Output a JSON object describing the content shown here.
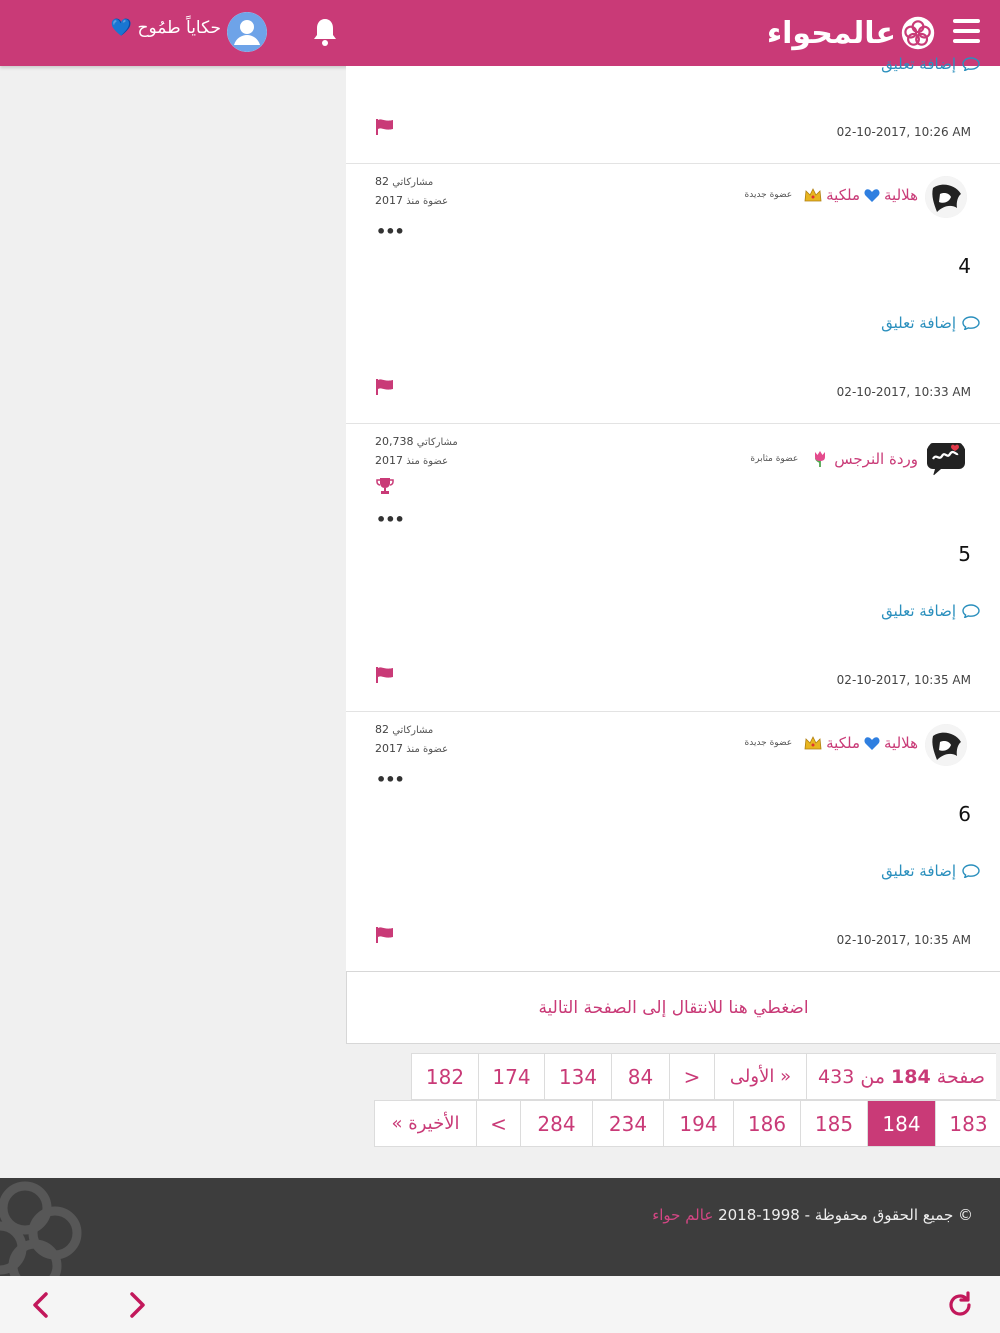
{
  "header": {
    "logo_text": "عالمحواء",
    "username": "حكاياً طمُوح 💙",
    "icons": {
      "menu": "hamburger-icon",
      "notifications": "bell-icon",
      "account": "avatar-icon"
    }
  },
  "colors": {
    "brand": "#c93a77",
    "link": "#2a8fbd",
    "footer": "#3d3d3d"
  },
  "top_partial": {
    "add_comment": "إضافة تعليق",
    "timestamp": "02-10-2017, 10:26 AM"
  },
  "posts": [
    {
      "author": "هلالية",
      "author_suffix": "ملكية",
      "rank": "عضوة جديدة",
      "posts_label": "مشاركاتي",
      "posts_count": "82",
      "member_since_label": "عضوة منذ",
      "member_since": "2017",
      "menu": "•••",
      "body": "4",
      "add_comment": "إضافة تعليق",
      "timestamp": "02-10-2017, 10:33 AM"
    },
    {
      "author": "وردة النرجس",
      "rank": "عضوة مثابرة",
      "posts_label": "مشاركاتي",
      "posts_count": "20,738",
      "member_since_label": "عضوة منذ",
      "member_since": "2017",
      "menu": "•••",
      "body": "5",
      "add_comment": "إضافة تعليق",
      "timestamp": "02-10-2017, 10:35 AM"
    },
    {
      "author": "هلالية",
      "author_suffix": "ملكية",
      "rank": "عضوة جديدة",
      "posts_label": "مشاركاتي",
      "posts_count": "82",
      "member_since_label": "عضوة منذ",
      "member_since": "2017",
      "menu": "•••",
      "body": "6",
      "add_comment": "إضافة تعليق",
      "timestamp": "02-10-2017, 10:35 AM"
    }
  ],
  "next_page": "اضغطي هنا للانتقال إلى الصفحة التالية",
  "pagination": {
    "info_prefix": "صفحة",
    "current": "184",
    "info_of": "من",
    "total": "433",
    "first": "« الأولى",
    "prev": "<",
    "row1": [
      "84",
      "134",
      "174",
      "182"
    ],
    "row2": [
      "183",
      "184",
      "185",
      "186",
      "194",
      "234",
      "284"
    ],
    "next": ">",
    "last": "الأخيرة »"
  },
  "footer": {
    "copyright": "© جميع الحقوق محفوظة - 1998-2018",
    "brand": "عالم حواء"
  },
  "toolbar": {
    "back": "chevron-left-icon",
    "forward": "chevron-right-icon",
    "reload": "reload-icon"
  }
}
